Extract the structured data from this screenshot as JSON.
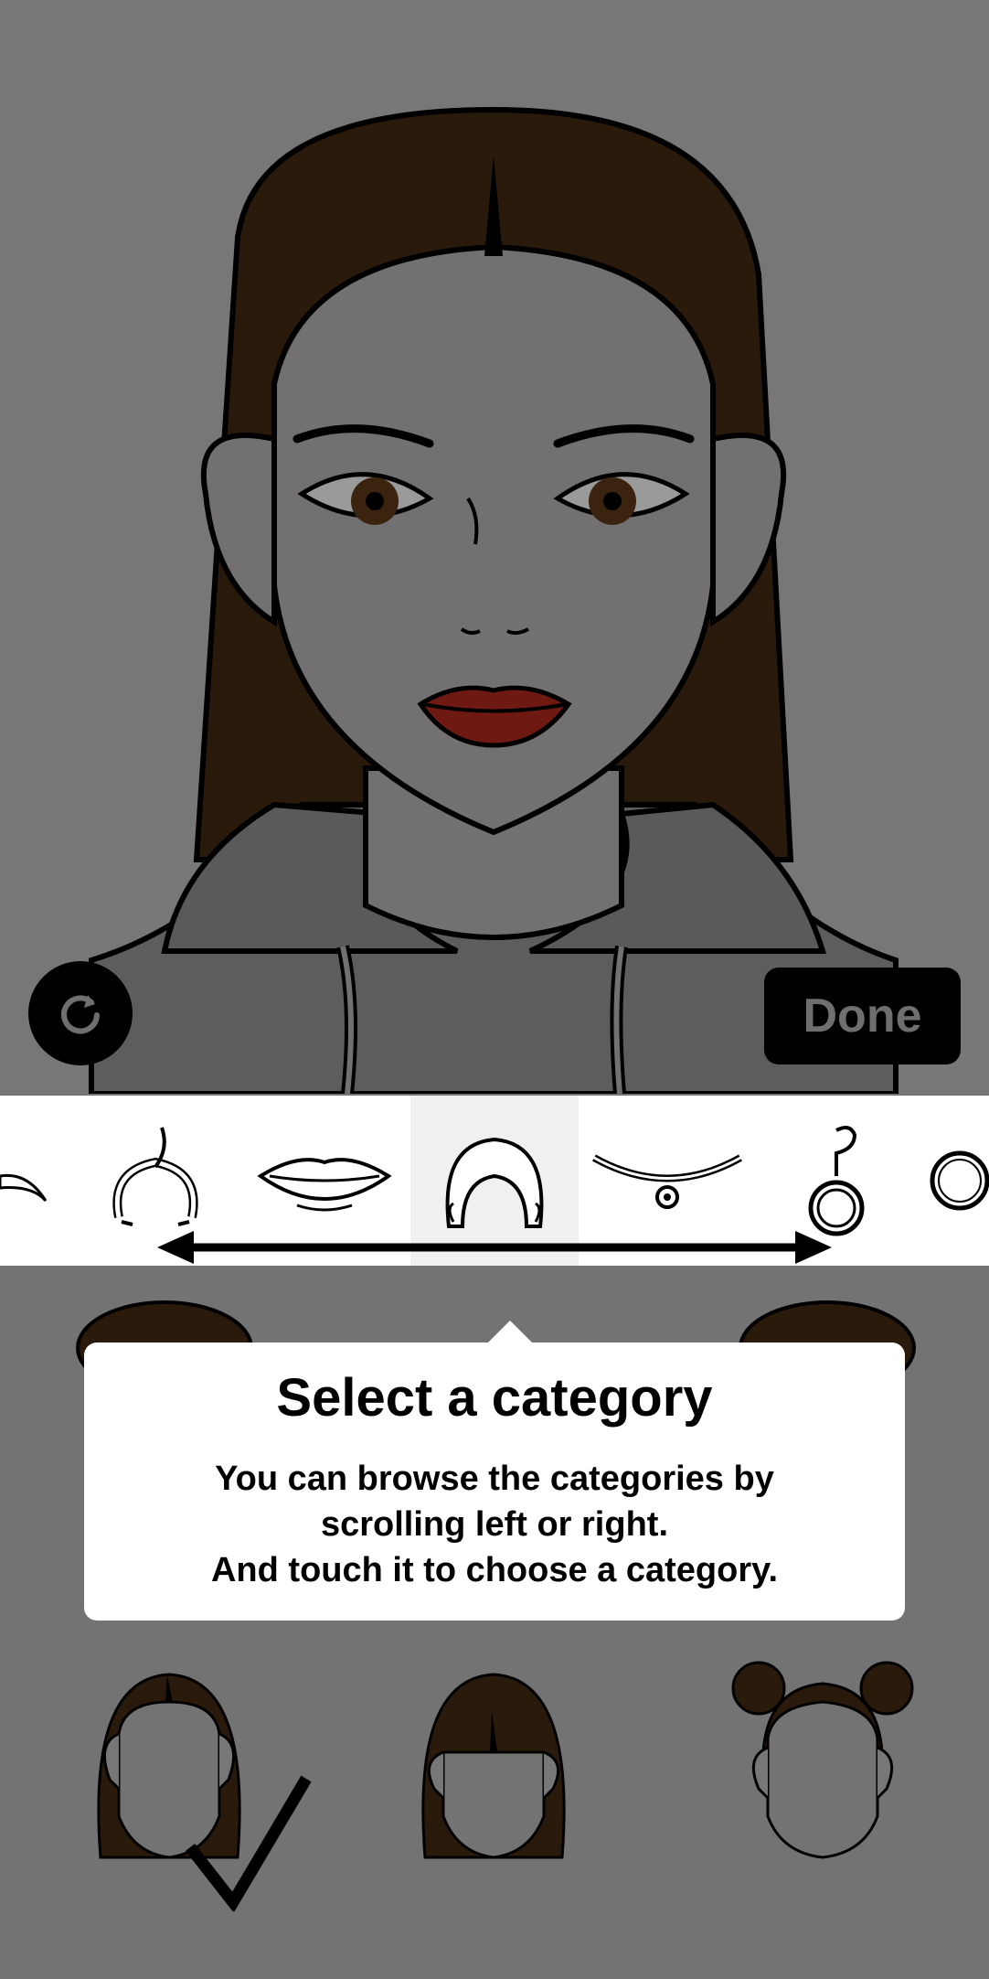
{
  "buttons": {
    "done_label": "Done",
    "refresh_icon": "refresh-icon"
  },
  "categories": [
    {
      "name": "eyebrows",
      "icon": "eyebrow-icon"
    },
    {
      "name": "headband",
      "icon": "headband-icon"
    },
    {
      "name": "lips",
      "icon": "lips-icon"
    },
    {
      "name": "hair",
      "icon": "hair-icon",
      "selected": true
    },
    {
      "name": "necklace",
      "icon": "necklace-icon"
    },
    {
      "name": "earrings",
      "icon": "earring-icon"
    },
    {
      "name": "glasses",
      "icon": "glasses-icon"
    }
  ],
  "tooltip": {
    "title": "Select a category",
    "body_lines": [
      "You can browse the categories by",
      "scrolling left or right.",
      "And touch it to choose a category."
    ]
  },
  "colors": {
    "overlay": "#737373",
    "hair": "#2a1a0c",
    "lips": "#6e1a12",
    "skin": "#727070",
    "hoodie": "#5d5d5d"
  }
}
